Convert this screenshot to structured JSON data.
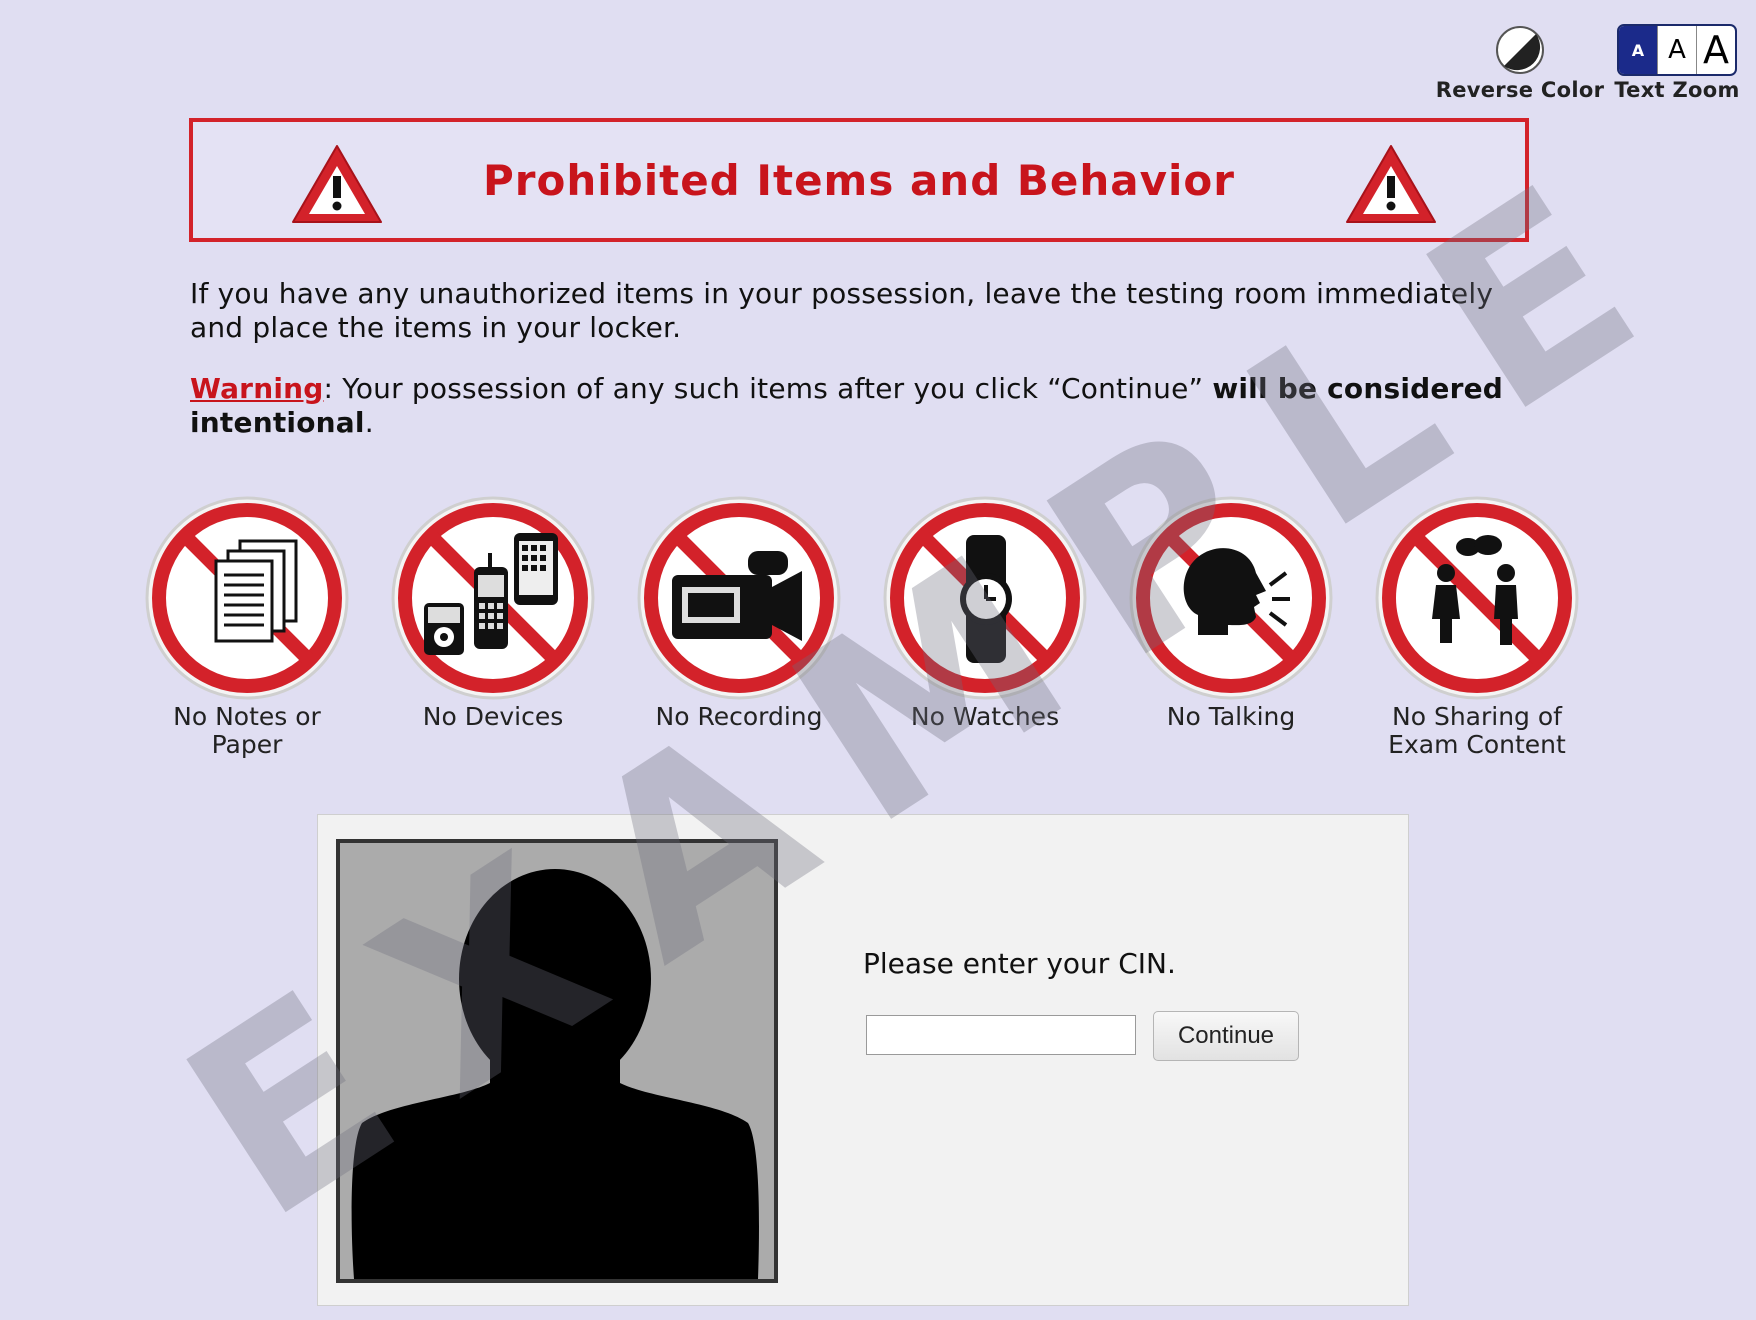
{
  "toolbar": {
    "reverse_color_label": "Reverse Color",
    "text_zoom_label": "Text Zoom",
    "zoom_levels": [
      "A",
      "A",
      "A"
    ]
  },
  "header": {
    "title": "Prohibited Items and Behavior"
  },
  "instructions": {
    "intro": "If you have any unauthorized items in your possession, leave the testing room immediately and place the items in your locker.",
    "warning_word": "Warning",
    "warning_text": ": Your possession of any such items after you click “Continue” ",
    "warning_bold": "will be considered intentional",
    "warning_end": "."
  },
  "signs": [
    {
      "icon": "notes-paper-icon",
      "label": "No Notes or\nPaper"
    },
    {
      "icon": "devices-icon",
      "label": "No Devices"
    },
    {
      "icon": "recording-camera-icon",
      "label": "No Recording"
    },
    {
      "icon": "watch-icon",
      "label": "No Watches"
    },
    {
      "icon": "talking-head-icon",
      "label": "No Talking"
    },
    {
      "icon": "sharing-people-icon",
      "label": "No Sharing of\nExam Content"
    }
  ],
  "cin_panel": {
    "prompt": "Please enter your CIN.",
    "input_value": "",
    "continue_label": "Continue"
  },
  "watermark": "EXAMPLE",
  "colors": {
    "background": "#e0def2",
    "accent_red": "#d3222a",
    "zoom_navy": "#1b2a8a"
  }
}
